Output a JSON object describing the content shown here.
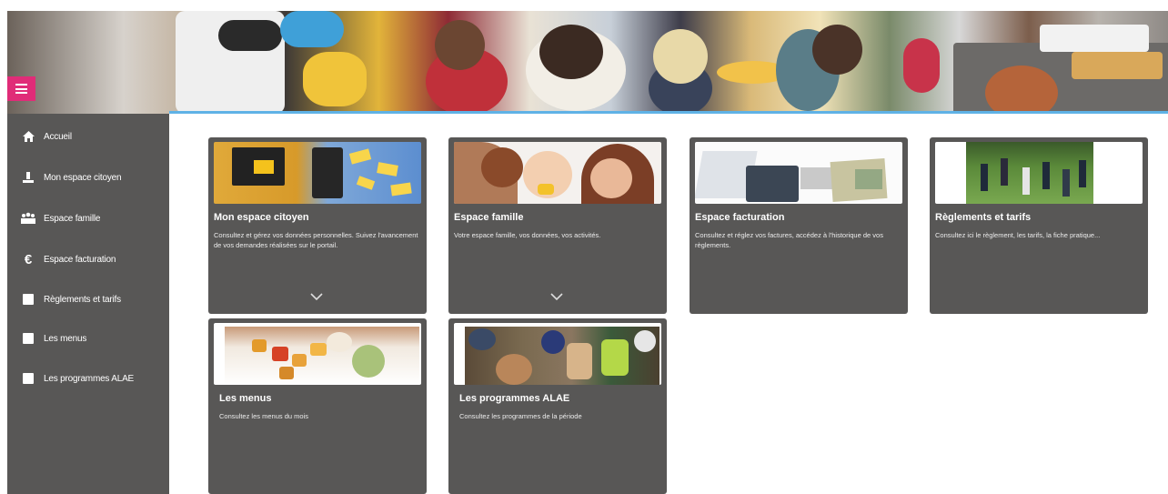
{
  "menu": {
    "items": [
      {
        "label": "Accueil",
        "icon": "home-icon"
      },
      {
        "label": "Mon espace citoyen",
        "icon": "user-icon"
      },
      {
        "label": "Espace famille",
        "icon": "family-icon"
      },
      {
        "label": "Espace facturation",
        "icon": "euro-icon"
      },
      {
        "label": "Règlements et tarifs",
        "icon": "square-icon"
      },
      {
        "label": "Les menus",
        "icon": "square-icon"
      },
      {
        "label": "Les programmes ALAE",
        "icon": "square-icon"
      }
    ]
  },
  "cards": [
    {
      "title": "Mon espace citoyen",
      "description": "Consultez et gérez vos données personnelles. Suivez l'avancement de vos demandes réalisées sur le portail.",
      "expandable": true
    },
    {
      "title": "Espace famille",
      "description": "Votre espace famille, vos données, vos activités.",
      "expandable": true
    },
    {
      "title": "Espace facturation",
      "description": "Consultez et réglez vos factures, accédez à l'historique de vos règlements.",
      "expandable": false
    },
    {
      "title": "Règlements et tarifs",
      "description": "Consultez ici le règlement, les tarifs, la fiche pratique...",
      "expandable": false
    },
    {
      "title": "Les menus",
      "description": "Consultez les menus du mois",
      "expandable": false
    },
    {
      "title": "Les programmes ALAE",
      "description": "Consultez les programmes de la période",
      "expandable": false
    }
  ],
  "colors": {
    "accent": "#e02c78",
    "sidebar": "#585756",
    "card": "#585756",
    "banner_line": "#5fb2e6"
  }
}
